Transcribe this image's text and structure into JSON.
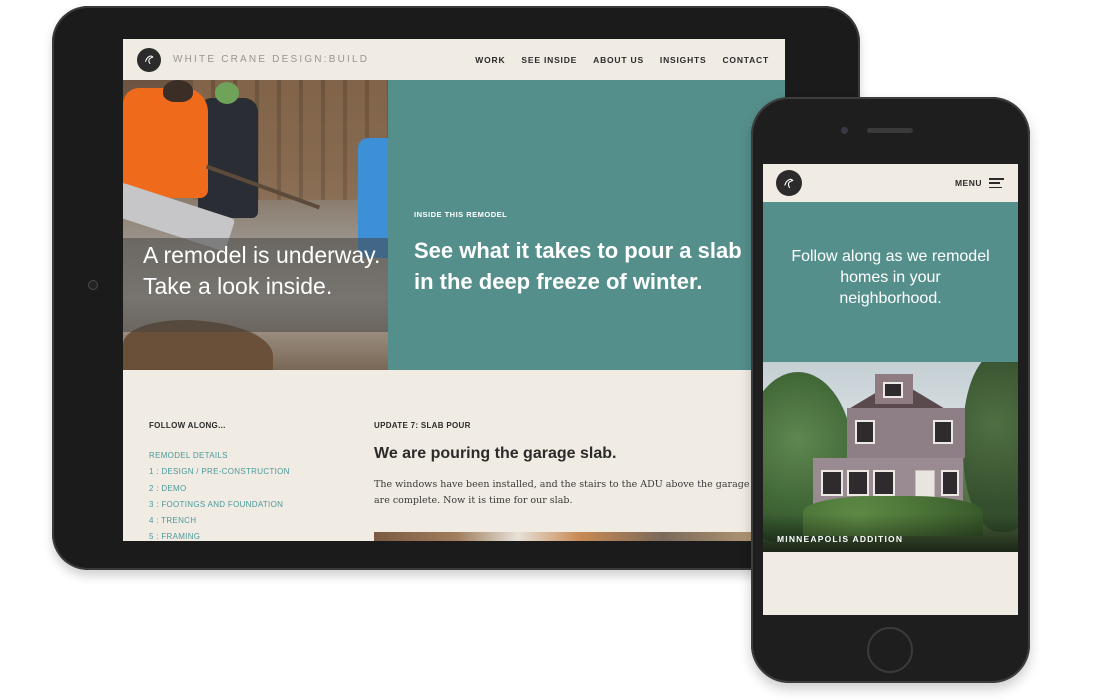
{
  "tablet": {
    "brand": "WHITE CRANE DESIGN:BUILD",
    "nav": [
      "WORK",
      "SEE INSIDE",
      "ABOUT US",
      "INSIGHTS",
      "CONTACT"
    ],
    "hero": {
      "caption": "A remodel is underway. Take a look inside.",
      "eyebrow": "INSIDE THIS REMODEL",
      "headline": "See what it takes to pour a slab in the deep freeze of winter."
    },
    "follow": {
      "title": "FOLLOW ALONG...",
      "items": [
        "REMODEL DETAILS",
        "1 : DESIGN / PRE-CONSTRUCTION",
        "2 : DEMO",
        "3 : FOOTINGS AND FOUNDATION",
        "4 : TRENCH",
        "5 : FRAMING"
      ]
    },
    "update": {
      "label": "UPDATE 7: SLAB POUR",
      "headline": "We are pouring the garage slab.",
      "text": "The windows have been installed, and the stairs to the ADU above the garage are complete. Now it is time for our slab."
    }
  },
  "phone": {
    "menu_label": "MENU",
    "hero_text": "Follow along as we remodel homes in your neighborhood.",
    "photo_caption": "MINNEAPOLIS ADDITION"
  },
  "colors": {
    "teal": "#558f8c",
    "cream": "#f0ebe3",
    "link": "#4c9a9a",
    "dark": "#2b2b2b"
  }
}
